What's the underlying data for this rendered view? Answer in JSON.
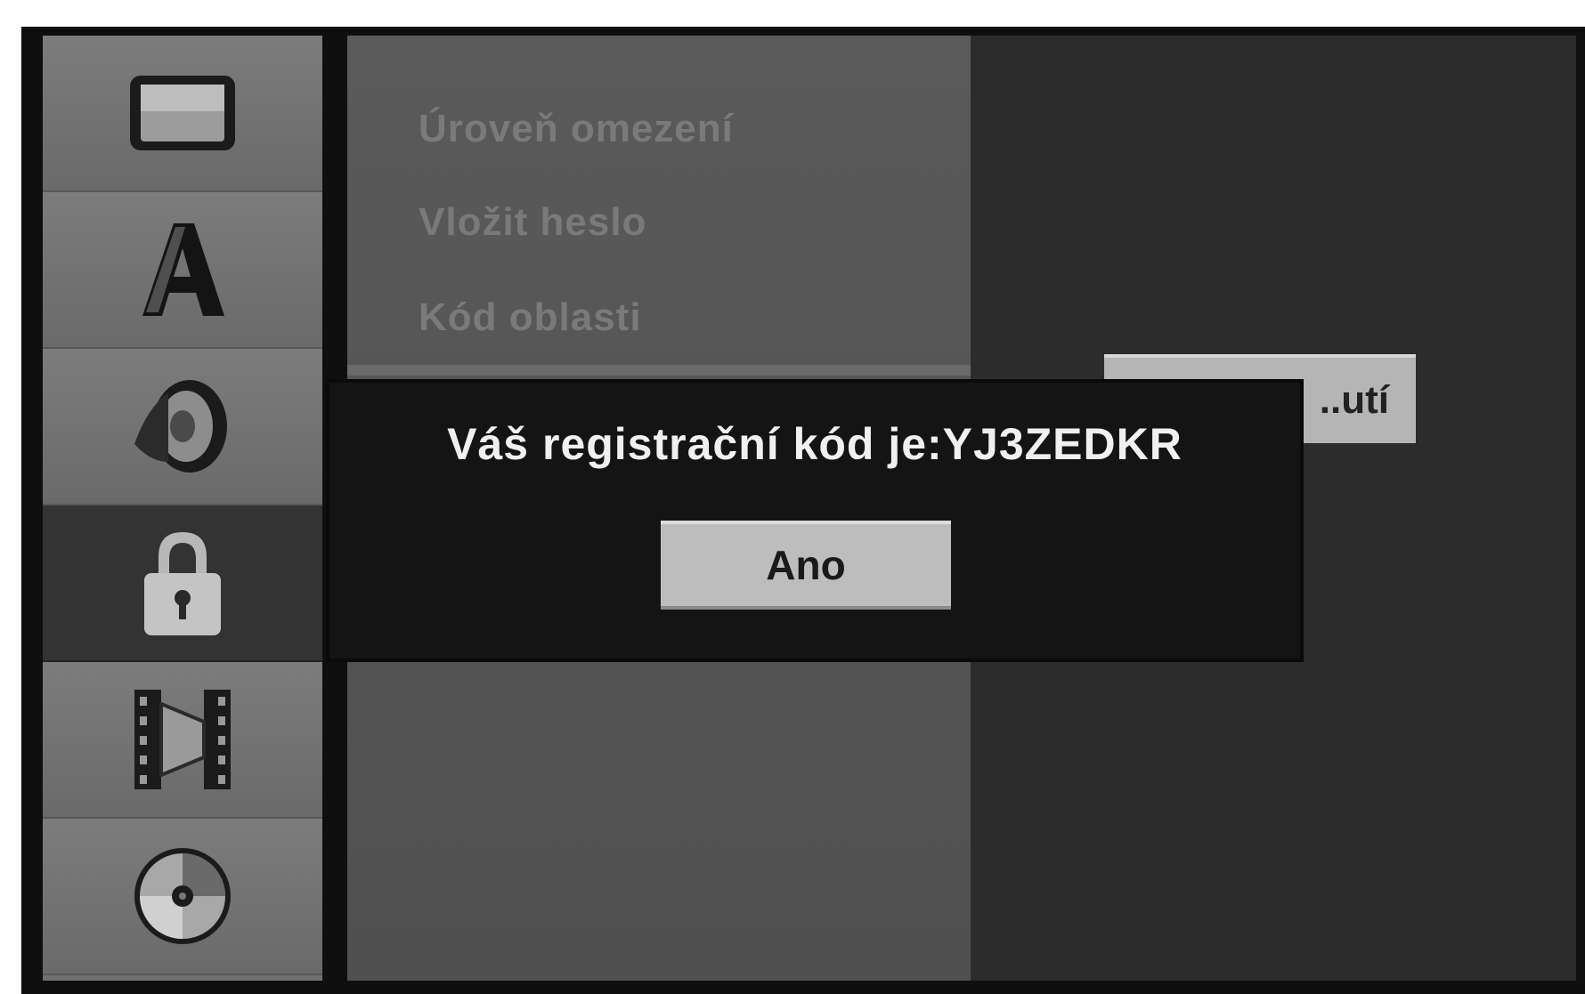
{
  "sidebar": {
    "items": [
      {
        "name": "display-icon"
      },
      {
        "name": "language-icon",
        "glyph": "A"
      },
      {
        "name": "audio-speaker-icon"
      },
      {
        "name": "lock-icon",
        "selected": true
      },
      {
        "name": "recording-film-icon"
      },
      {
        "name": "disc-icon"
      }
    ]
  },
  "menu": {
    "items": [
      {
        "label": "Úroveň omezení"
      },
      {
        "label": "Vložit heslo"
      },
      {
        "label": "Kód oblasti"
      }
    ]
  },
  "options": {
    "button_label": "..utí"
  },
  "dialog": {
    "message": "Váš registrační kód je:YJ3ZEDKR",
    "ok_label": "Ano"
  },
  "colors": {
    "selected_sidebar": "#333333",
    "button_face": "#bdbdbd",
    "dialog_bg": "#141414"
  }
}
